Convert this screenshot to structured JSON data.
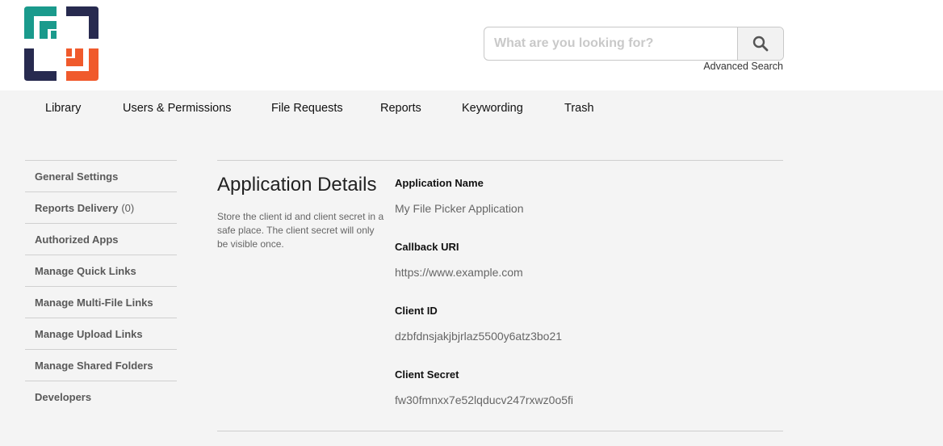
{
  "brand": {
    "logo_icon": "brackets-logo-icon",
    "colors": {
      "teal": "#1a9a8c",
      "navy": "#272a4f",
      "orange": "#f05a2c"
    }
  },
  "search": {
    "placeholder": "What are you looking for?",
    "button_icon": "search-icon",
    "advanced_label": "Advanced Search"
  },
  "nav": {
    "items": [
      {
        "label": "Library"
      },
      {
        "label": "Users & Permissions"
      },
      {
        "label": "File Requests"
      },
      {
        "label": "Reports"
      },
      {
        "label": "Keywording"
      },
      {
        "label": "Trash"
      }
    ]
  },
  "sidebar": {
    "items": [
      {
        "label": "General Settings"
      },
      {
        "label": "Reports Delivery",
        "count": "(0)"
      },
      {
        "label": "Authorized Apps"
      },
      {
        "label": "Manage Quick Links"
      },
      {
        "label": "Manage Multi-File Links"
      },
      {
        "label": "Manage Upload Links"
      },
      {
        "label": "Manage Shared Folders"
      },
      {
        "label": "Developers"
      }
    ]
  },
  "details": {
    "title": "Application Details",
    "description": "Store the client id and client secret in a safe place. The client secret will only be visible once.",
    "fields": [
      {
        "label": "Application Name",
        "value": "My File Picker Application"
      },
      {
        "label": "Callback URI",
        "value": "https://www.example.com"
      },
      {
        "label": "Client ID",
        "value": "dzbfdnsjakjbjrlaz5500y6atz3bo21"
      },
      {
        "label": "Client Secret",
        "value": "fw30fmnxx7e52lqducv247rxwz0o5fi"
      }
    ]
  }
}
